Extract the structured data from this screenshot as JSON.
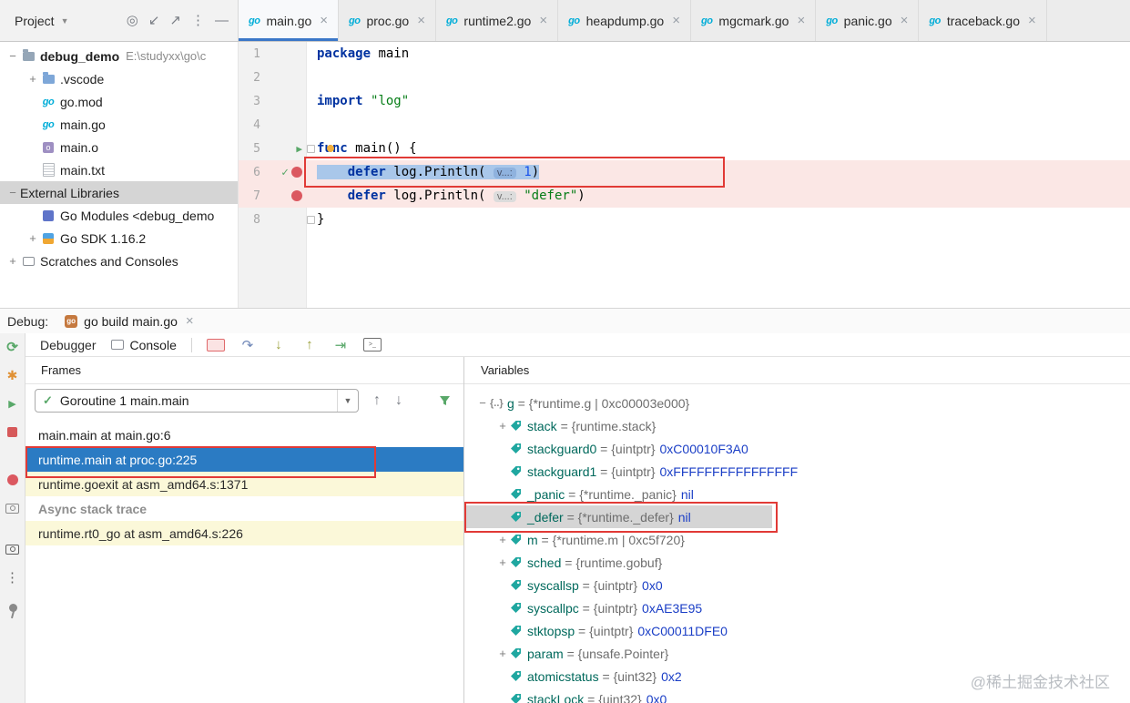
{
  "project_panel": {
    "title": "Project",
    "tree": [
      {
        "label": "debug_demo",
        "suffix": "E:\\studyxx\\go\\c",
        "icon": "folder-project",
        "expander": "minus",
        "indent": 0,
        "bold": true
      },
      {
        "label": ".vscode",
        "icon": "folder",
        "expander": "plus",
        "indent": 1
      },
      {
        "label": "go.mod",
        "icon": "go-file",
        "indent": 1
      },
      {
        "label": "main.go",
        "icon": "go-file",
        "indent": 1
      },
      {
        "label": "main.o",
        "icon": "obj-file",
        "indent": 1
      },
      {
        "label": "main.txt",
        "icon": "text-file",
        "indent": 1
      },
      {
        "label": "External Libraries",
        "expander": "minus",
        "indent": 0,
        "selected": true
      },
      {
        "label": "Go Modules <debug_demo",
        "icon": "module",
        "indent": 1
      },
      {
        "label": "Go SDK 1.16.2",
        "icon": "sdk",
        "expander": "plus",
        "indent": 1
      },
      {
        "label": "Scratches and Consoles",
        "icon": "scratches",
        "expander": "plus",
        "indent": 0
      }
    ]
  },
  "editor": {
    "tabs": [
      {
        "label": "main.go",
        "active": true
      },
      {
        "label": "proc.go"
      },
      {
        "label": "runtime2.go"
      },
      {
        "label": "heapdump.go"
      },
      {
        "label": "mgcmark.go"
      },
      {
        "label": "panic.go"
      },
      {
        "label": "traceback.go"
      }
    ],
    "lines": [
      {
        "num": "1",
        "segments": [
          {
            "c": "kw",
            "t": "package"
          },
          {
            "c": "plain",
            "t": " main"
          }
        ]
      },
      {
        "num": "2",
        "segments": []
      },
      {
        "num": "3",
        "segments": [
          {
            "c": "kw",
            "t": "import"
          },
          {
            "c": "plain",
            "t": " "
          },
          {
            "c": "str",
            "t": "\"log\""
          }
        ]
      },
      {
        "num": "4",
        "segments": []
      },
      {
        "num": "5",
        "gutter": "run",
        "fold": true,
        "segments": [
          {
            "c": "kw",
            "t": "func"
          },
          {
            "c": "plain",
            "t": " main() {"
          }
        ]
      },
      {
        "num": "6",
        "gutter": "check-bp",
        "bp": true,
        "exec": true,
        "segments": [
          {
            "c": "plain",
            "t": "    "
          },
          {
            "c": "kw",
            "t": "defer"
          },
          {
            "c": "plain",
            "t": " log.Println( "
          },
          {
            "c": "hint",
            "t": "v...:"
          },
          {
            "c": "plain",
            "t": " "
          },
          {
            "c": "num",
            "t": "1"
          },
          {
            "c": "plain",
            "t": ")"
          }
        ]
      },
      {
        "num": "7",
        "gutter": "bp",
        "bp": true,
        "segments": [
          {
            "c": "plain",
            "t": "    "
          },
          {
            "c": "kw",
            "t": "defer"
          },
          {
            "c": "plain",
            "t": " log.Println( "
          },
          {
            "c": "hint",
            "t": "v...:"
          },
          {
            "c": "plain",
            "t": " "
          },
          {
            "c": "str",
            "t": "\"defer\""
          },
          {
            "c": "plain",
            "t": ")"
          }
        ]
      },
      {
        "num": "8",
        "fold": true,
        "segments": [
          {
            "c": "plain",
            "t": "}"
          }
        ]
      }
    ]
  },
  "debug_bar": {
    "label": "Debug:",
    "tab": "go build main.go"
  },
  "debug_toolbar": {
    "debugger_label": "Debugger",
    "console_label": "Console",
    "icons": [
      {
        "name": "process-console-icon",
        "kind": "redsq",
        "glyph": ""
      },
      {
        "name": "step-over-icon",
        "kind": "stepover",
        "glyph": "↷"
      },
      {
        "name": "step-into-icon",
        "kind": "stepinto",
        "glyph": "↓"
      },
      {
        "name": "step-out-icon",
        "kind": "stepout",
        "glyph": "↑"
      },
      {
        "name": "run-to-cursor-icon",
        "kind": "runto",
        "glyph": "⇥"
      },
      {
        "name": "command-line-icon",
        "kind": "cmd",
        "glyph": ">_"
      }
    ]
  },
  "frames": {
    "header": "Frames",
    "goroutine": "Goroutine 1 main.main",
    "rows": [
      {
        "text": "main.main at main.go:6",
        "style": "plain"
      },
      {
        "text": "runtime.main at proc.go:225",
        "style": "selected",
        "annotated": true
      },
      {
        "text": "runtime.goexit at asm_amd64.s:1371",
        "style": "lib"
      },
      {
        "text": "Async stack trace",
        "style": "separator"
      },
      {
        "text": "runtime.rt0_go at asm_amd64.s:226",
        "style": "lib"
      }
    ]
  },
  "variables": {
    "header": "Variables",
    "rows": [
      {
        "expander": "minus",
        "icon": "braces",
        "name": "g",
        "gray": "{*runtime.g | 0xc00003e000}",
        "indent": 0
      },
      {
        "expander": "plus",
        "icon": "tag",
        "name": "stack",
        "gray": "{runtime.stack}",
        "indent": 1
      },
      {
        "icon": "tag",
        "name": "stackguard0",
        "gray": "{uintptr}",
        "blue": "0xC00010F3A0",
        "indent": 1
      },
      {
        "icon": "tag",
        "name": "stackguard1",
        "gray": "{uintptr}",
        "blue": "0xFFFFFFFFFFFFFFFF",
        "indent": 1
      },
      {
        "icon": "tag",
        "name": "_panic",
        "gray": "{*runtime._panic}",
        "blue": "nil",
        "indent": 1
      },
      {
        "icon": "tag",
        "name": "_defer",
        "gray": "{*runtime._defer}",
        "blue": "nil",
        "indent": 1,
        "selected": true,
        "annotated": true
      },
      {
        "expander": "plus",
        "icon": "tag",
        "name": "m",
        "gray": "{*runtime.m | 0xc5f720}",
        "indent": 1
      },
      {
        "expander": "plus",
        "icon": "tag",
        "name": "sched",
        "gray": "{runtime.gobuf}",
        "indent": 1
      },
      {
        "icon": "tag",
        "name": "syscallsp",
        "gray": "{uintptr}",
        "blue": "0x0",
        "indent": 1
      },
      {
        "icon": "tag",
        "name": "syscallpc",
        "gray": "{uintptr}",
        "blue": "0xAE3E95",
        "indent": 1
      },
      {
        "icon": "tag",
        "name": "stktopsp",
        "gray": "{uintptr}",
        "blue": "0xC00011DFE0",
        "indent": 1
      },
      {
        "expander": "plus",
        "icon": "tag",
        "name": "param",
        "gray": "{unsafe.Pointer}",
        "indent": 1
      },
      {
        "icon": "tag",
        "name": "atomicstatus",
        "gray": "{uint32}",
        "blue": "0x2",
        "indent": 1
      },
      {
        "icon": "tag",
        "name": "stackLock",
        "gray": "{uint32}",
        "blue": "0x0",
        "indent": 1
      }
    ]
  },
  "left_toolbar": [
    {
      "name": "rerun-icon",
      "kind": "rerun",
      "glyph": "⟳"
    },
    {
      "name": "settings-icon",
      "kind": "gear",
      "glyph": "✱"
    },
    {
      "name": "resume-icon",
      "kind": "resume",
      "glyph": "▶"
    },
    {
      "name": "stop-icon",
      "kind": "stop",
      "glyph": ""
    },
    {
      "name": "view-breakpoints-icon",
      "kind": "bp",
      "glyph": "",
      "gap": 22
    },
    {
      "name": "screenshot-icon",
      "kind": "camera",
      "glyph": ""
    },
    {
      "name": "memory-view-icon",
      "kind": "camera2",
      "glyph": "",
      "gap": 14
    },
    {
      "name": "more-icon",
      "kind": "more",
      "glyph": "⋮"
    },
    {
      "name": "pin-icon",
      "kind": "pin",
      "glyph": "",
      "gap": 6
    }
  ],
  "colors": {
    "accent_blue": "#3B77C8",
    "selection_blue": "#2B7BC3",
    "breakpoint_red": "#DB5860",
    "exec_highlight": "#A9C7EA",
    "breakpoint_line": "#FBE7E5",
    "annotation_red": "#E13A36",
    "go_brand": "#00ADD8"
  },
  "watermark": "@稀土掘金技术社区"
}
